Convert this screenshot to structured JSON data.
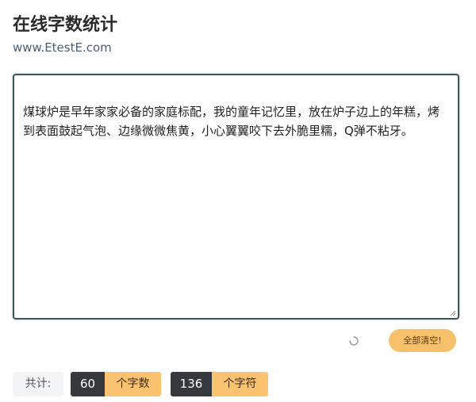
{
  "header": {
    "title": "在线字数统计",
    "site": "www.EtestE.com"
  },
  "editor": {
    "text": "煤球炉是早年家家必备的家庭标配，我的童年记忆里，放在炉子边上的年糕，烤到表面鼓起气泡、边缘微微焦黄，小心翼翼咬下去外脆里糯，Q弹不粘牙。"
  },
  "toolbar": {
    "clear_label": "全部清空!"
  },
  "stats": {
    "total_label": "共计:",
    "char_count": "60",
    "char_unit": "个字数",
    "symbol_count": "136",
    "symbol_unit": "个字符"
  },
  "colors": {
    "accent": "#fbc36f",
    "dark": "#35383c",
    "border": "#3f5558",
    "link": "#4a5e7a"
  },
  "icons": {
    "loading": "spinner-icon",
    "resize": "resize-grip-icon"
  }
}
